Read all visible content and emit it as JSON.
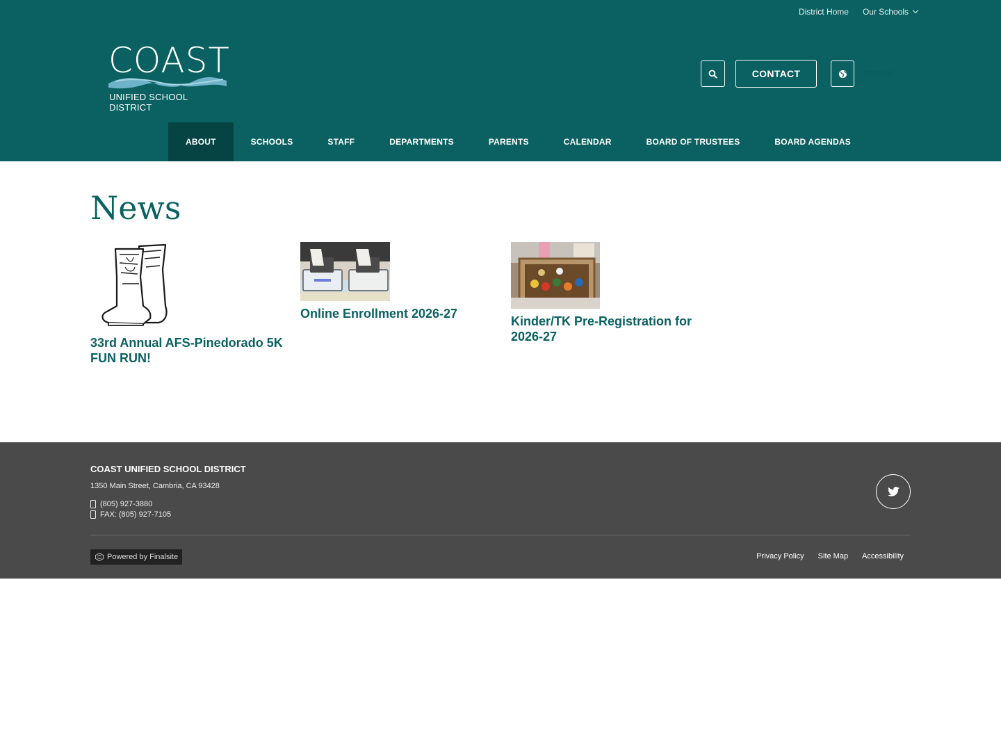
{
  "utility_nav": {
    "district_home": "District Home",
    "our_schools": "Our Schools"
  },
  "logo": {
    "word": "COAST",
    "subtitle": "UNIFIED SCHOOL DISTRICT"
  },
  "header_actions": {
    "contact": "CONTACT",
    "translate": "Translate"
  },
  "main_nav": [
    {
      "label": "ABOUT",
      "active": true
    },
    {
      "label": "SCHOOLS"
    },
    {
      "label": "STAFF"
    },
    {
      "label": "DEPARTMENTS"
    },
    {
      "label": "PARENTS"
    },
    {
      "label": "CALENDAR"
    },
    {
      "label": "BOARD OF TRUSTEES"
    },
    {
      "label": "BOARD AGENDAS"
    }
  ],
  "page": {
    "title": "News"
  },
  "news": [
    {
      "title": "33rd Annual AFS-Pinedorado 5K FUN RUN!",
      "image": "cowboy-boots-drawing"
    },
    {
      "title": "Online Enrollment 2026-27",
      "image": "hands-on-laptops-photo"
    },
    {
      "title": "Kinder/TK Pre-Registration for 2026-27",
      "image": "classroom-toys-photo"
    }
  ],
  "footer": {
    "org_name": "COAST UNIFIED SCHOOL DISTRICT",
    "address": "1350 Main Street, Cambria, CA 93428",
    "phone": "(805) 927-3880",
    "fax": "FAX: (805) 927-7105",
    "powered_by": "Powered by Finalsite",
    "links": [
      "Privacy Policy",
      "Site Map",
      "Accessibility"
    ]
  },
  "colors": {
    "brand_teal": "#0b6161",
    "nav_active": "#064444",
    "footer_bg": "#4a4a4a"
  }
}
